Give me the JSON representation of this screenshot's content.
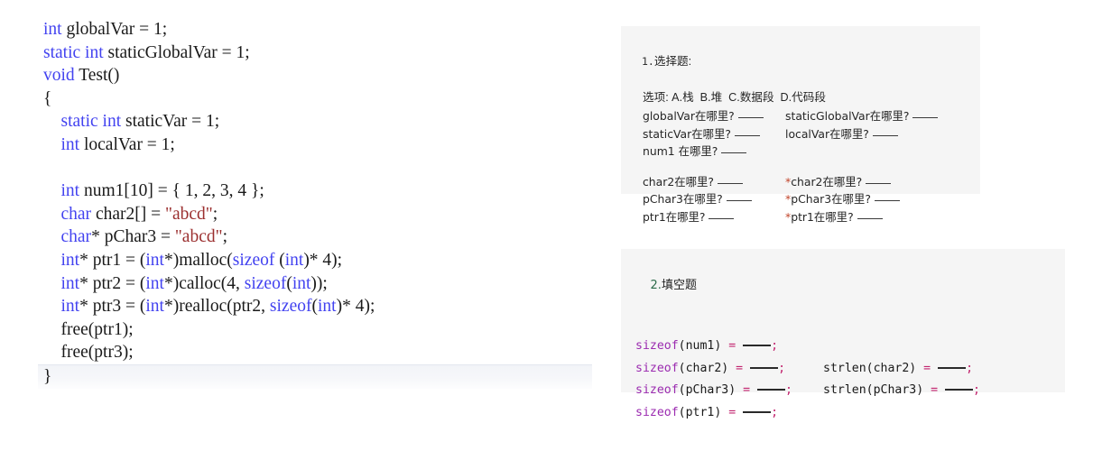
{
  "code": {
    "lines": [
      [
        {
          "t": "int",
          "c": "kw"
        },
        {
          "t": " globalVar = 1;",
          "c": "pl"
        }
      ],
      [
        {
          "t": "static int",
          "c": "kw"
        },
        {
          "t": " staticGlobalVar = 1;",
          "c": "pl"
        }
      ],
      [
        {
          "t": "void",
          "c": "kw"
        },
        {
          "t": " Test()",
          "c": "pl"
        }
      ],
      [
        {
          "t": "{",
          "c": "pl"
        }
      ],
      [
        {
          "t": "    ",
          "c": "pl"
        },
        {
          "t": "static int",
          "c": "kw"
        },
        {
          "t": " staticVar = 1;",
          "c": "pl"
        }
      ],
      [
        {
          "t": "    ",
          "c": "pl"
        },
        {
          "t": "int",
          "c": "kw"
        },
        {
          "t": " localVar = 1;",
          "c": "pl"
        }
      ],
      [
        {
          "t": "",
          "c": "pl"
        }
      ],
      [
        {
          "t": "    ",
          "c": "pl"
        },
        {
          "t": "int",
          "c": "kw"
        },
        {
          "t": " num1[10] = { 1, 2, 3, 4 };",
          "c": "pl"
        }
      ],
      [
        {
          "t": "    ",
          "c": "pl"
        },
        {
          "t": "char",
          "c": "kw"
        },
        {
          "t": " char2[] = ",
          "c": "pl"
        },
        {
          "t": "\"abcd\"",
          "c": "str"
        },
        {
          "t": ";",
          "c": "pl"
        }
      ],
      [
        {
          "t": "    ",
          "c": "pl"
        },
        {
          "t": "char",
          "c": "kw"
        },
        {
          "t": "* pChar3 = ",
          "c": "pl"
        },
        {
          "t": "\"abcd\"",
          "c": "str"
        },
        {
          "t": ";",
          "c": "pl"
        }
      ],
      [
        {
          "t": "    ",
          "c": "pl"
        },
        {
          "t": "int",
          "c": "kw"
        },
        {
          "t": "* ptr1 = (",
          "c": "pl"
        },
        {
          "t": "int",
          "c": "kw"
        },
        {
          "t": "*)malloc(",
          "c": "pl"
        },
        {
          "t": "sizeof",
          "c": "kw"
        },
        {
          "t": " (",
          "c": "pl"
        },
        {
          "t": "int",
          "c": "kw"
        },
        {
          "t": ")* 4);",
          "c": "pl"
        }
      ],
      [
        {
          "t": "    ",
          "c": "pl"
        },
        {
          "t": "int",
          "c": "kw"
        },
        {
          "t": "* ptr2 = (",
          "c": "pl"
        },
        {
          "t": "int",
          "c": "kw"
        },
        {
          "t": "*)calloc(4, ",
          "c": "pl"
        },
        {
          "t": "sizeof",
          "c": "kw"
        },
        {
          "t": "(",
          "c": "pl"
        },
        {
          "t": "int",
          "c": "kw"
        },
        {
          "t": "));",
          "c": "pl"
        }
      ],
      [
        {
          "t": "    ",
          "c": "pl"
        },
        {
          "t": "int",
          "c": "kw"
        },
        {
          "t": "* ptr3 = (",
          "c": "pl"
        },
        {
          "t": "int",
          "c": "kw"
        },
        {
          "t": "*)realloc(ptr2, ",
          "c": "pl"
        },
        {
          "t": "sizeof",
          "c": "kw"
        },
        {
          "t": "(",
          "c": "pl"
        },
        {
          "t": "int",
          "c": "kw"
        },
        {
          "t": ")* 4);",
          "c": "pl"
        }
      ],
      [
        {
          "t": "    free(ptr1);",
          "c": "pl"
        }
      ],
      [
        {
          "t": "    free(ptr3);",
          "c": "pl"
        }
      ],
      [
        {
          "t": "}",
          "c": "pl"
        }
      ]
    ]
  },
  "panel_choice": {
    "number": "1.",
    "title": "选择题:",
    "options_line": "选项: A.栈  B.堆  C.数据段  D.代码段",
    "rows_group1": [
      {
        "left": "globalVar在哪里?",
        "right": "staticGlobalVar在哪里?"
      },
      {
        "left": "staticVar在哪里?",
        "right": "localVar在哪里?"
      },
      {
        "left": "num1 在哪里?",
        "right": ""
      }
    ],
    "rows_group2": [
      {
        "left": "char2在哪里?",
        "right_star": "*",
        "right": "char2在哪里?"
      },
      {
        "left": "pChar3在哪里?",
        "right_star": "*",
        "right": "pChar3在哪里?"
      },
      {
        "left": "ptr1在哪里?",
        "right_star": "*",
        "right": "ptr1在哪里?"
      }
    ]
  },
  "panel_fill": {
    "number": "2.",
    "title": "填空题",
    "rows": [
      {
        "left_fn": "sizeof",
        "left_arg": "(num1)",
        "right_fn": "",
        "right_arg": ""
      },
      {
        "left_fn": "sizeof",
        "left_arg": "(char2)",
        "right_fn": "strlen",
        "right_arg": "(char2)"
      },
      {
        "left_fn": "sizeof",
        "left_arg": "(pChar3)",
        "right_fn": "strlen",
        "right_arg": "(pChar3)"
      },
      {
        "left_fn": "sizeof",
        "left_arg": "(ptr1)",
        "right_fn": "",
        "right_arg": ""
      }
    ],
    "equals": "=",
    "semicolon": ";"
  },
  "colors": {
    "keyword": "#4343f0",
    "string": "#9b2f2f",
    "panel_bg": "#f5f5f5",
    "sizeof_purple": "#9b2bb0",
    "operator_pink": "#c2246e",
    "star_red": "#c1442a",
    "page_bg": "#ffffff"
  }
}
